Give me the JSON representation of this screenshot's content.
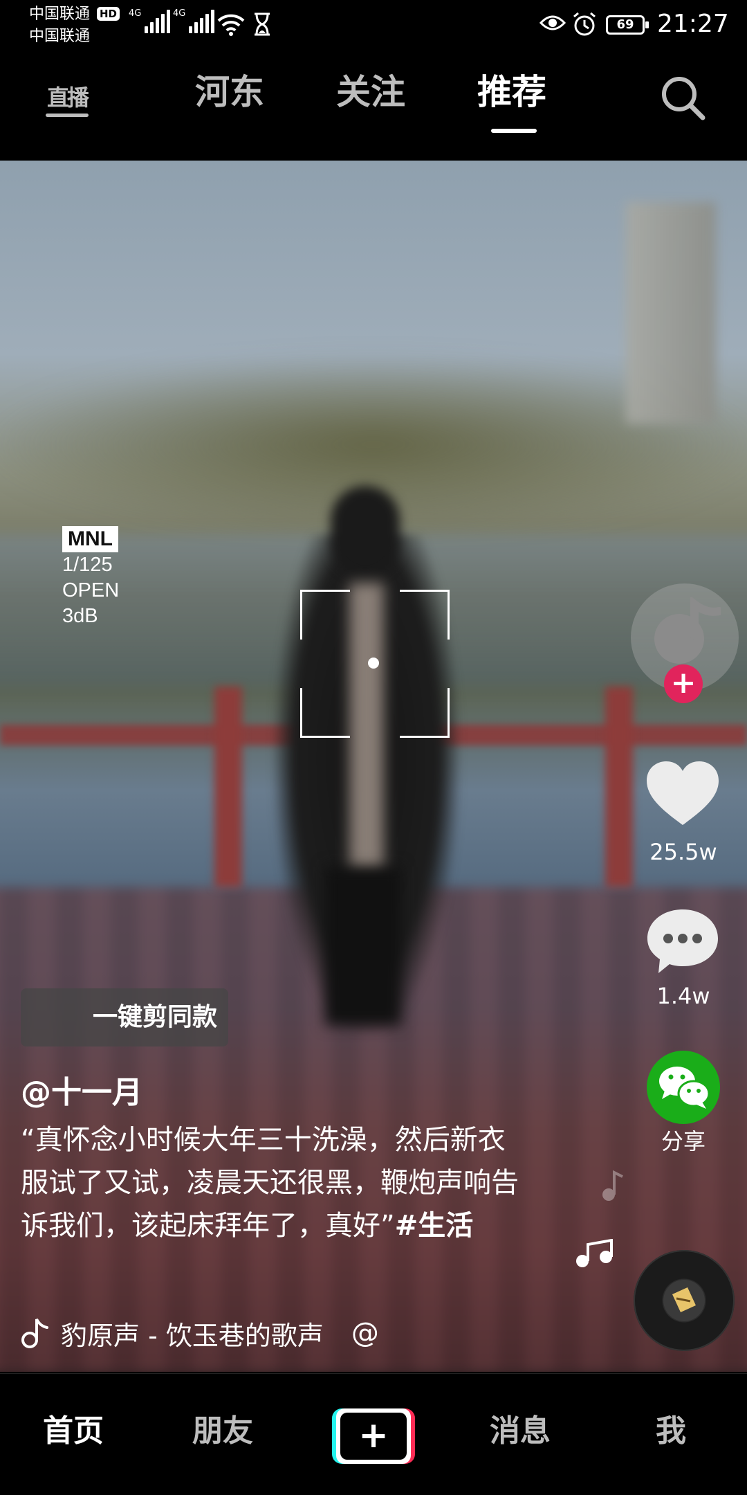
{
  "status_bar": {
    "carrier_1": "中国联通",
    "hd_badge": "HD",
    "carrier_2": "中国联通",
    "network_1": "4G",
    "network_2": "4G",
    "battery": "69",
    "time": "21:27"
  },
  "top_nav": {
    "live_icon_text": "直播",
    "tabs": [
      {
        "label": "河东",
        "active": false
      },
      {
        "label": "关注",
        "active": false
      },
      {
        "label": "推荐",
        "active": true
      }
    ]
  },
  "video": {
    "camera_badge": "MNL",
    "camera_lines": [
      "1/125",
      "OPEN",
      "3dB"
    ]
  },
  "actions": {
    "like_count": "25.5w",
    "comment_count": "1.4w",
    "share_label": "分享",
    "follow_symbol": "+"
  },
  "post": {
    "oneclick_label": "一键剪同款",
    "author": "@十一月",
    "description": "“真怀念小时候大年三十洗澡，然后新衣服试了又试，凌晨天还很黑，鞭炮声响告诉我们，该起床拜年了，真好”",
    "hashtag": "#生活",
    "music": "豹原声 - 饮玉巷的歌声",
    "music_at": "@"
  },
  "bottom_nav": {
    "home": "首页",
    "friends": "朋友",
    "create": "+",
    "messages": "消息",
    "me": "我"
  },
  "colors": {
    "like_red": "#e1245c",
    "wechat_green": "#1aad19",
    "create_cyan": "#25f4ee",
    "create_pink": "#fe2c55"
  }
}
